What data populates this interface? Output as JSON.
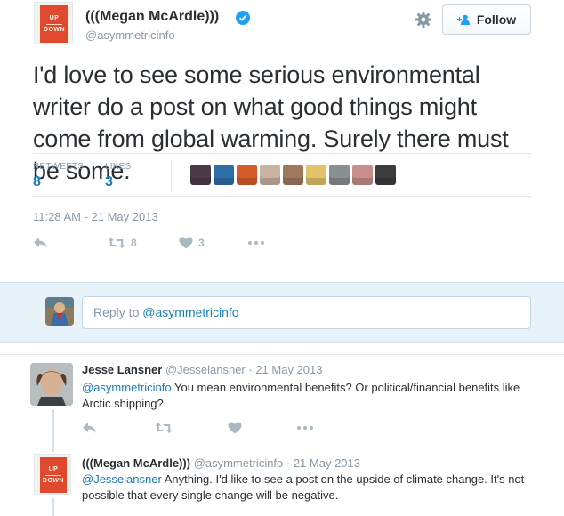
{
  "main_tweet": {
    "author_name": "(((Megan McArdle)))",
    "handle": "@asymmetricinfo",
    "avatar_text_top": "UP",
    "avatar_text_bottom": "DOWN",
    "follow_label": "Follow",
    "text": "I'd love to see some serious environmental writer do a post on what good things might come from global warming. Surely there must be some.",
    "retweets_label": "RETWEETS",
    "retweets_count": "8",
    "likes_label": "LIKES",
    "likes_count": "3",
    "timestamp": "11:28 AM - 21 May 2013",
    "action_retweet_count": "8",
    "action_like_count": "3",
    "liker_colors": [
      "#4a3a4a",
      "#2f6fa8",
      "#d85b2a",
      "#c9b3a1",
      "#a07a5e",
      "#e2c26a",
      "#8a8f96",
      "#c98e8e",
      "#3c3c3c"
    ]
  },
  "reply_box": {
    "placeholder_prefix": "Reply to ",
    "placeholder_mention": "@asymmetricinfo"
  },
  "replies": [
    {
      "author_name": "Jesse Lansner",
      "handle_time": "@Jesselansner · 21 May 2013",
      "mention": "@asymmetricinfo",
      "text": " You mean environmental benefits? Or political/financial benefits like Arctic shipping?"
    },
    {
      "author_name": "(((Megan McArdle)))",
      "handle_time": "@asymmetricinfo · 21 May 2013",
      "mention": "@Jesselansner",
      "text": " Anything. I'd like to see a post on the upside of climate change. It's not possible that every single change will be negative."
    }
  ],
  "colors": {
    "accent": "#1b7eb5",
    "muted": "#8899a6",
    "reply_bg": "#e8f2f9",
    "verified": "#1da1f2"
  }
}
